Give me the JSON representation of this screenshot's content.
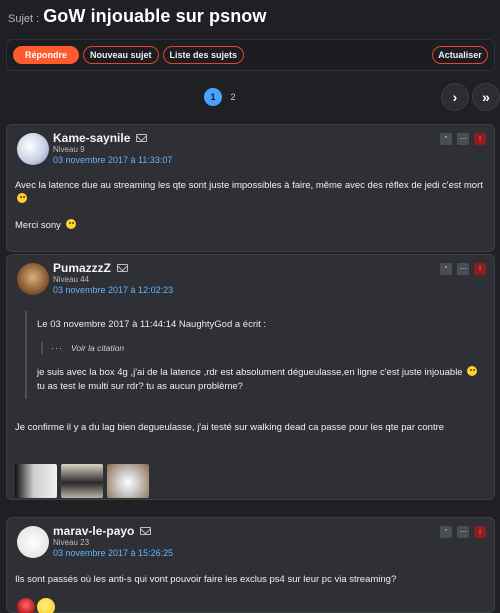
{
  "topic": {
    "prefix": "Sujet :",
    "title": "GoW injouable sur psnow"
  },
  "actions": {
    "reply": "Répondre",
    "new_topic": "Nouveau sujet",
    "topic_list": "Liste des sujets",
    "refresh": "Actualiser"
  },
  "pagination": {
    "pages": [
      "1",
      "2"
    ],
    "current": "1",
    "next_icon": "chevron-right-icon",
    "last_icon": "skip-to-end-icon",
    "next_glyph": "›",
    "last_glyph": "»"
  },
  "post_actions": {
    "quote_glyph": "\"",
    "more_glyph": "⋯",
    "alert_glyph": "!"
  },
  "posts": [
    {
      "author": "Kame-saynile",
      "level": "Niveau 9",
      "date": "03 novembre 2017 à 11:33:07",
      "paragraphs": [
        "Avec la latence due au streaming les qte sont juste impossibles à faire, même avec des réflex de jedi c'est mort",
        "Merci sony"
      ]
    },
    {
      "author": "PumazzzZ",
      "level": "Niveau 44",
      "date": "03 novembre 2017 à 12:02:23",
      "quote": {
        "header": "Le 03 novembre 2017 à 11:44:14 NaughtyGod a écrit :",
        "dots": "···",
        "see_quote": "Voir la citation",
        "line1": "je suis avec la box 4g ,j'ai de la latence ,rdr est absolument dégueulasse,en ligne c'est juste injouable",
        "line2": "tu as test le multi sur rdr? tu as aucun problème?"
      },
      "text": "Je confirme il y a du lag bien degueulasse, j'ai testé sur walking dead ca passe pour les qte par contre"
    },
    {
      "author": "marav-le-payo",
      "level": "Niveau 23",
      "date": "03 novembre 2017 à 15:26:25",
      "text": "Ils sont passés où les anti-s qui vont pouvoir faire les exclus ps4 sur leur pc via streaming?"
    }
  ]
}
